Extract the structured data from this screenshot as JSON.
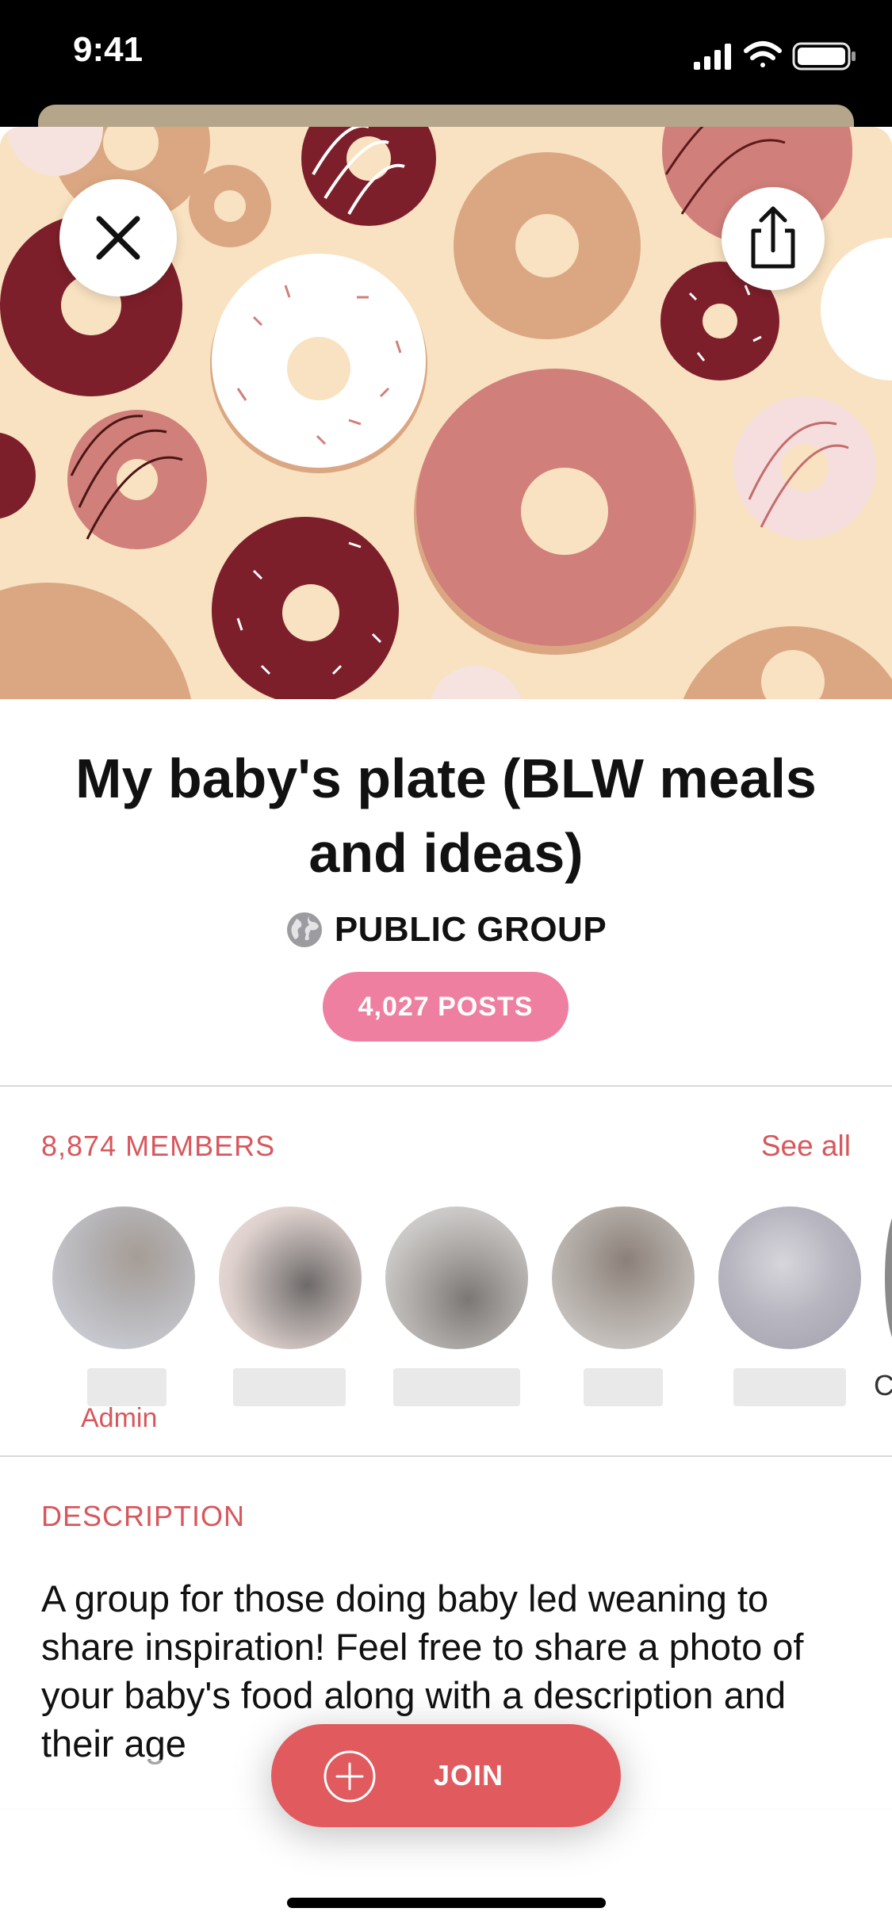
{
  "status_bar": {
    "time": "9:41"
  },
  "group": {
    "title": "My baby's plate (BLW meals and ideas)",
    "type_label": "PUBLIC GROUP",
    "posts_label": "4,027 POSTS"
  },
  "members": {
    "count_label": "8,874 MEMBERS",
    "see_all_label": "See all",
    "admin_label": "Admin",
    "cut_off_name_letter": "C"
  },
  "description": {
    "heading": "DESCRIPTION",
    "text": "A group for those doing baby led weaning to share inspiration! Feel free to share a photo of your baby's food along with a description and their age"
  },
  "join": {
    "label": "JOIN"
  },
  "colors": {
    "accent": "#e15a5e",
    "accent_text": "#d8575c",
    "posts_pill": "#ee7fa0",
    "hero_background": "#f8e2c1"
  },
  "icons": [
    "close-icon",
    "share-icon",
    "globe-icon",
    "plus-circle-icon",
    "signal-icon",
    "wifi-icon",
    "battery-icon"
  ]
}
